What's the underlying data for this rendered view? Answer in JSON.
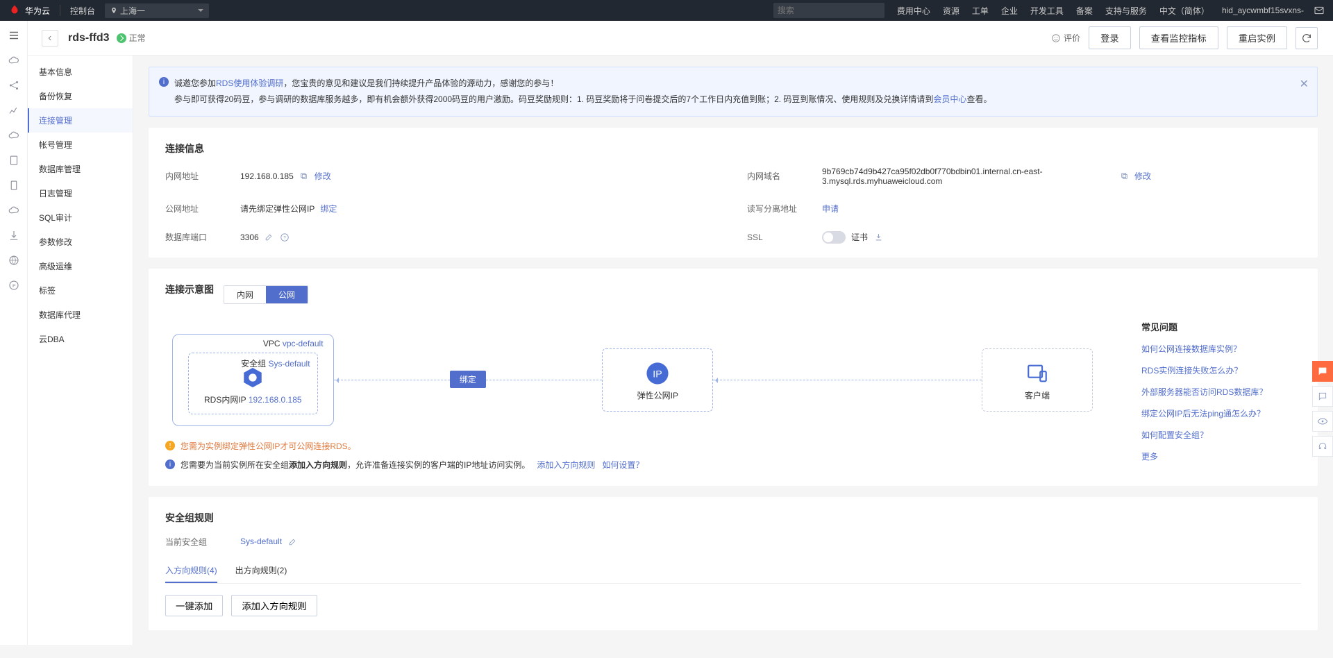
{
  "topbar": {
    "brand": "华为云",
    "console": "控制台",
    "region": "上海一",
    "search_ph": "搜索",
    "nav": [
      "费用中心",
      "资源",
      "工单",
      "企业",
      "开发工具",
      "备案",
      "支持与服务",
      "中文（简体）"
    ],
    "user": "hid_aycwmbf15svxns-"
  },
  "header": {
    "title": "rds-ffd3",
    "status": "正常",
    "rate": "评价",
    "login": "登录",
    "metrics": "查看监控指标",
    "reboot": "重启实例"
  },
  "sidenav": [
    "基本信息",
    "备份恢复",
    "连接管理",
    "帐号管理",
    "数据库管理",
    "日志管理",
    "SQL审计",
    "参数修改",
    "高级运维",
    "标签",
    "数据库代理",
    "云DBA"
  ],
  "sidenav_active": 2,
  "banner": {
    "l1_a": "诚邀您参加",
    "l1_link": "RDS使用体验调研",
    "l1_b": "，您宝贵的意见和建议是我们持续提升产品体验的源动力，感谢您的参与！",
    "l2_a": "参与即可获得20码豆，参与调研的数据库服务越多，即有机会额外获得2000码豆的用户激励。码豆奖励规则：1. 码豆奖励将于问卷提交后的7个工作日内充值到账；2. 码豆到账情况、使用规则及兑换详情请到",
    "l2_link": "会员中心",
    "l2_b": "查看。"
  },
  "conn": {
    "title": "连接信息",
    "rows": {
      "intra_addr_lbl": "内网地址",
      "intra_addr": "192.168.0.185",
      "modify": "修改",
      "intra_domain_lbl": "内网域名",
      "intra_domain": "9b769cb74d9b427ca95f02db0f770bdbin01.internal.cn-east-3.mysql.rds.myhuaweicloud.com",
      "pub_addr_lbl": "公网地址",
      "pub_addr_hint": "请先绑定弹性公网IP",
      "bind": "绑定",
      "rw_lbl": "读写分离地址",
      "apply": "申请",
      "port_lbl": "数据库端口",
      "port": "3306",
      "ssl_lbl": "SSL",
      "cert": "证书"
    }
  },
  "diagram": {
    "title": "连接示意图",
    "tabs": [
      "内网",
      "公网"
    ],
    "active": 1,
    "vpc_prefix": "VPC",
    "vpc": "vpc-default",
    "sg_prefix": "安全组",
    "sg": "Sys-default",
    "rds_lbl": "RDS内网IP",
    "rds_ip": "192.168.0.185",
    "bind_btn": "绑定",
    "eip_lbl": "弹性公网IP",
    "client_lbl": "客户端",
    "warn": "您需为实例绑定弹性公网IP才可公网连接RDS。",
    "info_a": "您需要为当前实例所在安全组",
    "info_b": "添加入方向规则",
    "info_c": "，允许准备连接实例的客户端的IP地址访问实例。",
    "add_rule": "添加入方向规则",
    "how_set": "如何设置？"
  },
  "faq": {
    "title": "常见问题",
    "items": [
      "如何公网连接数据库实例？",
      "RDS实例连接失败怎么办？",
      "外部服务器能否访问RDS数据库？",
      "绑定公网IP后无法ping通怎么办？",
      "如何配置安全组？"
    ],
    "more": "更多"
  },
  "sg": {
    "title": "安全组规则",
    "cur_lbl": "当前安全组",
    "cur": "Sys-default",
    "tab_in": "入方向规则(4)",
    "tab_out": "出方向规则(2)",
    "btn_batch": "一键添加",
    "btn_add": "添加入方向规则"
  }
}
